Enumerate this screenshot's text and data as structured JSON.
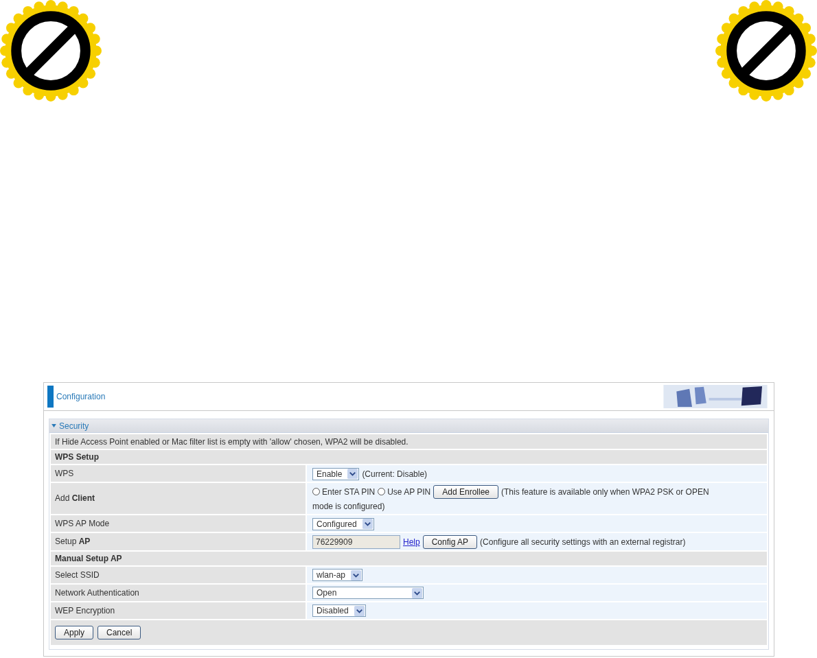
{
  "panel": {
    "title": "Configuration"
  },
  "section": {
    "title": "Security",
    "expanded": true
  },
  "rows": [
    {
      "kind": "note",
      "text": "If Hide Access Point enabled or Mac filter list is empty with 'allow' chosen, WPA2 will be disabled."
    },
    {
      "kind": "heading",
      "text": "WPS Setup"
    },
    {
      "kind": "field",
      "label": "WPS",
      "parts": [
        {
          "kind": "select",
          "value": "Enable"
        },
        {
          "kind": "text",
          "text": "(Current: Disable)"
        }
      ]
    },
    {
      "kind": "field",
      "label": "Add **Client**",
      "parts": [
        {
          "kind": "radio",
          "label": "Enter STA PIN",
          "selected": false
        },
        {
          "kind": "radio",
          "label": "Use AP PIN",
          "selected": false
        },
        {
          "kind": "button",
          "label": "Add Enrollee"
        },
        {
          "kind": "text",
          "text": "(This feature is available only when WPA2 PSK or OPEN"
        },
        {
          "kind": "text",
          "text": "mode is configured)"
        }
      ]
    },
    {
      "kind": "field",
      "label": "WPS AP Mode",
      "parts": [
        {
          "kind": "select",
          "value": "Configured"
        }
      ]
    },
    {
      "kind": "field",
      "label": "Setup **AP**",
      "parts": [
        {
          "kind": "input",
          "value": "76229909"
        },
        {
          "kind": "link",
          "text": "Help"
        },
        {
          "kind": "button",
          "label": "Config AP"
        },
        {
          "kind": "text",
          "text": "(Configure all security settings with an external registrar)"
        }
      ]
    },
    {
      "kind": "heading",
      "text": "Manual Setup AP"
    },
    {
      "kind": "field",
      "label": "Select SSID",
      "parts": [
        {
          "kind": "select",
          "value": "wlan-ap"
        }
      ]
    },
    {
      "kind": "field",
      "label": "Network Authentication",
      "parts": [
        {
          "kind": "select",
          "value": "Open",
          "wide": true
        }
      ]
    },
    {
      "kind": "field",
      "label": "WEP Encryption",
      "parts": [
        {
          "kind": "select",
          "value": "Disabled"
        }
      ]
    }
  ],
  "buttons": [
    "Apply",
    "Cancel"
  ]
}
